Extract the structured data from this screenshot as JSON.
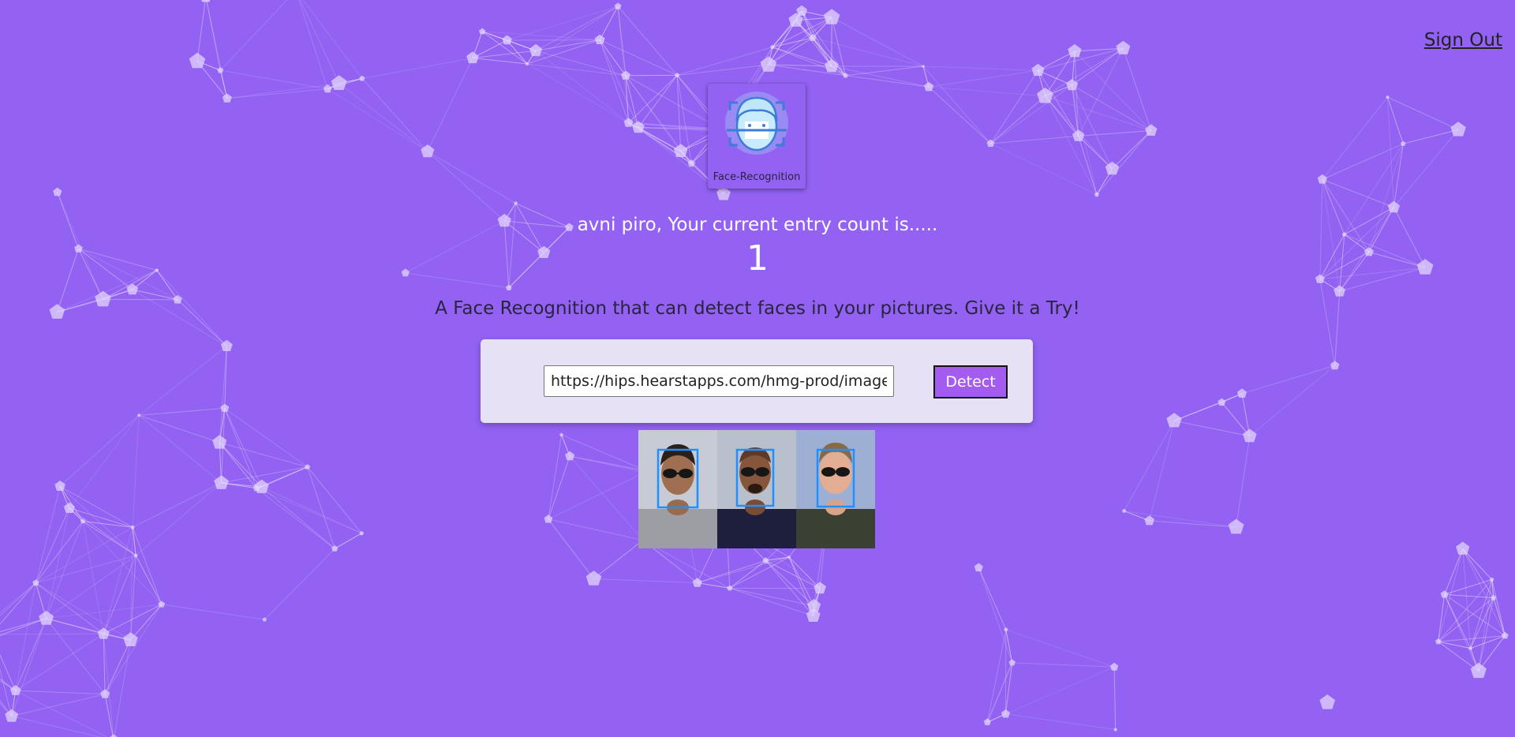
{
  "header": {
    "sign_out_label": "Sign Out"
  },
  "logo": {
    "caption": "Face-Recognition"
  },
  "rank": {
    "greeting": "avni piro, Your current entry count is.....",
    "count": "1"
  },
  "tagline": "A Face Recognition that can detect faces in your pictures. Give it a Try!",
  "form": {
    "url_value": "https://hips.hearstapps.com/hmg-prod/images/f",
    "detect_label": "Detect"
  },
  "colors": {
    "background": "#9362f2",
    "detect_button": "#a45bef",
    "form_panel": "#e6e1f4",
    "face_box": "#1e90ff"
  }
}
